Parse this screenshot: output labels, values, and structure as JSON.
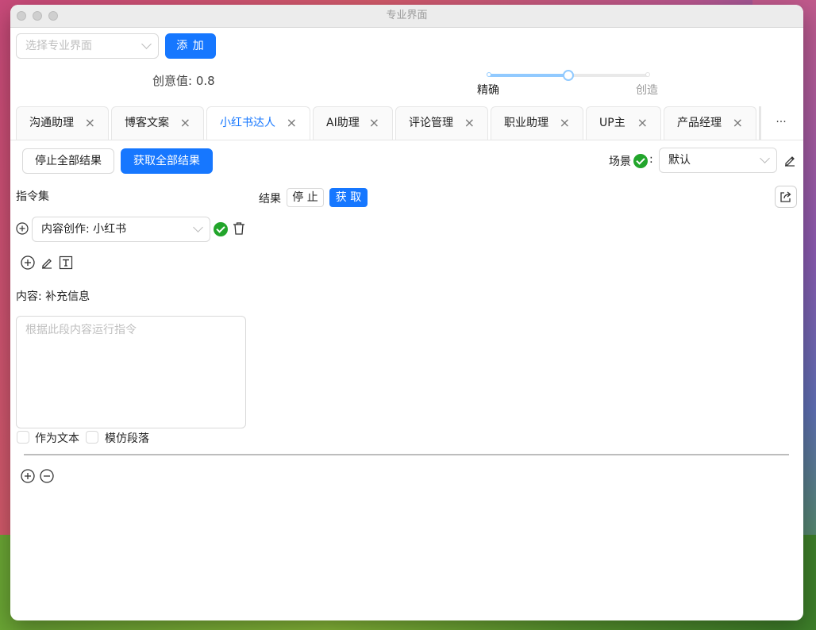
{
  "window": {
    "title": "专业界面"
  },
  "top": {
    "select_placeholder": "选择专业界面",
    "add_label": "添 加",
    "creativity_label": "创意值: 0.8",
    "slider": {
      "value": 0.8,
      "left_label": "精确",
      "right_label": "创造"
    }
  },
  "tabs": [
    {
      "label": "沟通助理"
    },
    {
      "label": "博客文案"
    },
    {
      "label": "小红书达人",
      "active": true
    },
    {
      "label": "AI助理"
    },
    {
      "label": "评论管理"
    },
    {
      "label": "职业助理"
    },
    {
      "label": "UP主"
    },
    {
      "label": "产品经理"
    }
  ],
  "tabs_more": "···",
  "toolbar": {
    "stop_all": "停止全部结果",
    "get_all": "获取全部结果",
    "scene_label": "场景",
    "scene_colon": ":",
    "scene_value": "默认"
  },
  "left": {
    "section_title": "指令集",
    "instruction_value": "内容创作: 小红书",
    "content_label": "内容: 补充信息",
    "textarea_placeholder": "根据此段内容运行指令",
    "as_text_label": "作为文本",
    "imitate_label": "模仿段落"
  },
  "result": {
    "label": "结果",
    "stop": "停 止",
    "get": "获 取"
  },
  "colors": {
    "primary": "#1677ff",
    "success": "#22a52b"
  }
}
